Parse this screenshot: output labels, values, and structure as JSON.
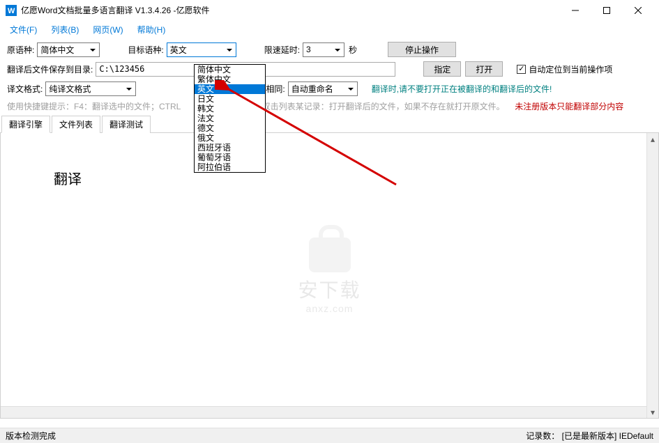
{
  "window": {
    "title": "亿愿Word文档批量多语言翻译 V1.3.4.26 -亿愿软件"
  },
  "menu": {
    "file": "文件(F)",
    "list": "列表(B)",
    "web": "网页(W)",
    "help": "帮助(H)"
  },
  "row1": {
    "source_lang_label": "原语种:",
    "source_lang_value": "简体中文",
    "target_lang_label": "目标语种:",
    "target_lang_value": "英文",
    "delay_label": "限速延时:",
    "delay_value": "3",
    "seconds": "秒",
    "stop_btn": "停止操作"
  },
  "row2": {
    "save_dir_label": "翻译后文件保存到目录:",
    "save_dir_value": "C:\\123456",
    "assign_btn": "指定",
    "open_btn": "打开",
    "auto_locate": "自动定位到当前操作项"
  },
  "row3": {
    "format_label": "译文格式:",
    "format_value": "纯译文格式",
    "same_name_label": "文件名相同:",
    "same_name_value": "自动重命名",
    "teal_hint": "翻译时,请不要打开正在被翻译的和翻译后的文件!"
  },
  "hint": {
    "gray1": "使用快捷键提示：F4：翻译选中的文件；CTRL",
    "gray2": "双击列表某记录：打开翻译后的文件，如果不存在就打开原文件。",
    "red": "未注册版本只能翻译部分内容"
  },
  "tabs": {
    "engine": "翻译引擎",
    "filelist": "文件列表",
    "test": "翻译测试"
  },
  "content": {
    "big_text": "翻译"
  },
  "dropdown": {
    "options": [
      "简体中文",
      "繁体中文",
      "英文",
      "日文",
      "韩文",
      "法文",
      "德文",
      "俄文",
      "西班牙语",
      "葡萄牙语",
      "阿拉伯语"
    ],
    "selected_index": 2
  },
  "statusbar": {
    "left": "版本检测完成",
    "right": "记录数：  [已是最新版本]  IEDefault"
  },
  "watermark": {
    "cn": "安下载",
    "en": "anxz.com"
  }
}
